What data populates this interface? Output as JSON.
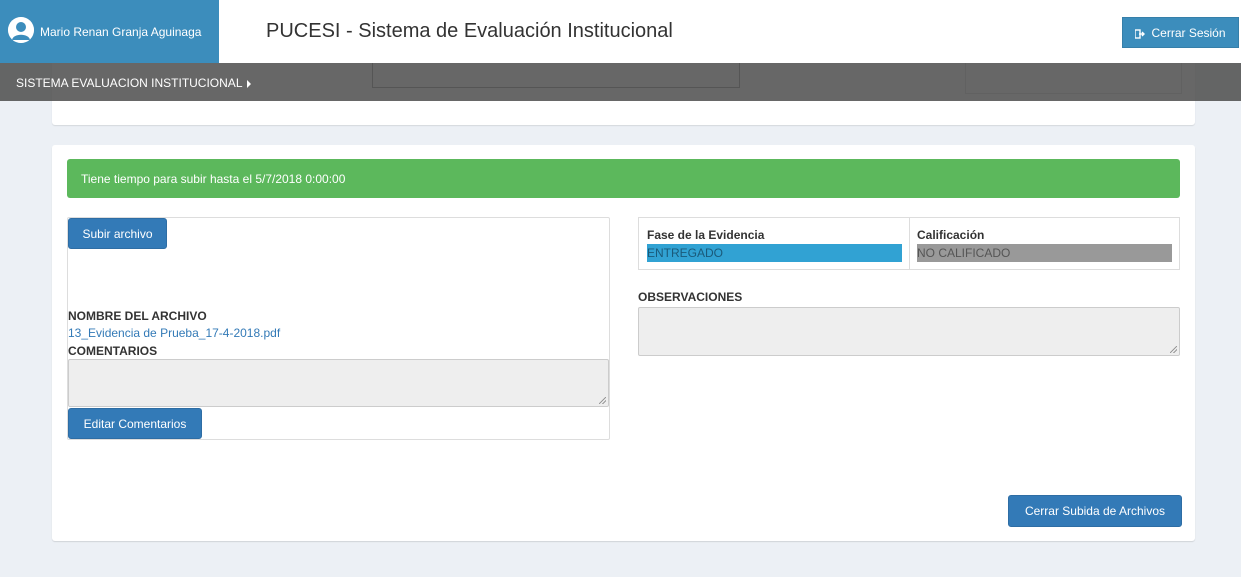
{
  "header": {
    "user_name": "Mario Renan Granja Aguinaga",
    "app_title": "PUCESI - Sistema de Evaluación Institucional",
    "logout_label": "Cerrar Sesión"
  },
  "navbar": {
    "item_label": "SISTEMA EVALUACION INSTITUCIONAL"
  },
  "alert": {
    "message": "Tiene tiempo para subir hasta el 5/7/2018 0:00:00"
  },
  "upload": {
    "upload_button": "Subir archivo",
    "file_name_label": "NOMBRE DEL ARCHIVO",
    "file_name": "13_Evidencia de Prueba_17-4-2018.pdf",
    "comments_label": "COMENTARIOS",
    "comments_value": "",
    "edit_comments_button": "Editar Comentarios"
  },
  "evidence": {
    "phase_header": "Fase de la Evidencia",
    "phase_value": "ENTREGADO",
    "grade_header": "Calificación",
    "grade_value": "NO CALIFICADO",
    "observations_label": "OBSERVACIONES",
    "observations_value": ""
  },
  "footer": {
    "close_upload_button": "Cerrar Subida de Archivos"
  },
  "colors": {
    "primary": "#3c8dbc",
    "button": "#337ab7",
    "success": "#5cb85c",
    "phase_badge": "#31a2d3",
    "grade_badge": "#999999"
  }
}
